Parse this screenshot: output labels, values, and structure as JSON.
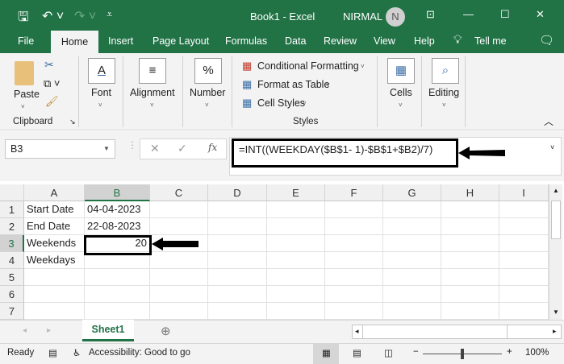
{
  "title": {
    "doc": "Book1  -  Excel",
    "user": "NIRMAL",
    "avatar": "N"
  },
  "tabs": [
    "File",
    "Home",
    "Insert",
    "Page Layout",
    "Formulas",
    "Data",
    "Review",
    "View",
    "Help",
    "Tell me"
  ],
  "ribbon": {
    "paste": "Paste",
    "clipboard": "Clipboard",
    "font": "Font",
    "alignment": "Alignment",
    "number": "Number",
    "conditional": "Conditional Formatting",
    "format_table": "Format as Table",
    "cell_styles": "Cell Styles",
    "styles": "Styles",
    "cells": "Cells",
    "editing": "Editing"
  },
  "formula_bar": {
    "name_box": "B3",
    "formula": "=INT((WEEKDAY($B$1- 1)-$B$1+$B2)/7)",
    "fx": "fx"
  },
  "columns": [
    "A",
    "B",
    "C",
    "D",
    "E",
    "F",
    "G",
    "H",
    "I"
  ],
  "rows": [
    "1",
    "2",
    "3",
    "4",
    "5",
    "6",
    "7"
  ],
  "cells": {
    "A1": "Start Date",
    "B1": "04-04-2023",
    "A2": "End Date",
    "B2": "22-08-2023",
    "A3": "Weekends",
    "B3": "20",
    "A4": "Weekdays"
  },
  "sheet_tab": "Sheet1",
  "status": {
    "ready": "Ready",
    "accessibility": "Accessibility: Good to go",
    "zoom": "100%"
  }
}
